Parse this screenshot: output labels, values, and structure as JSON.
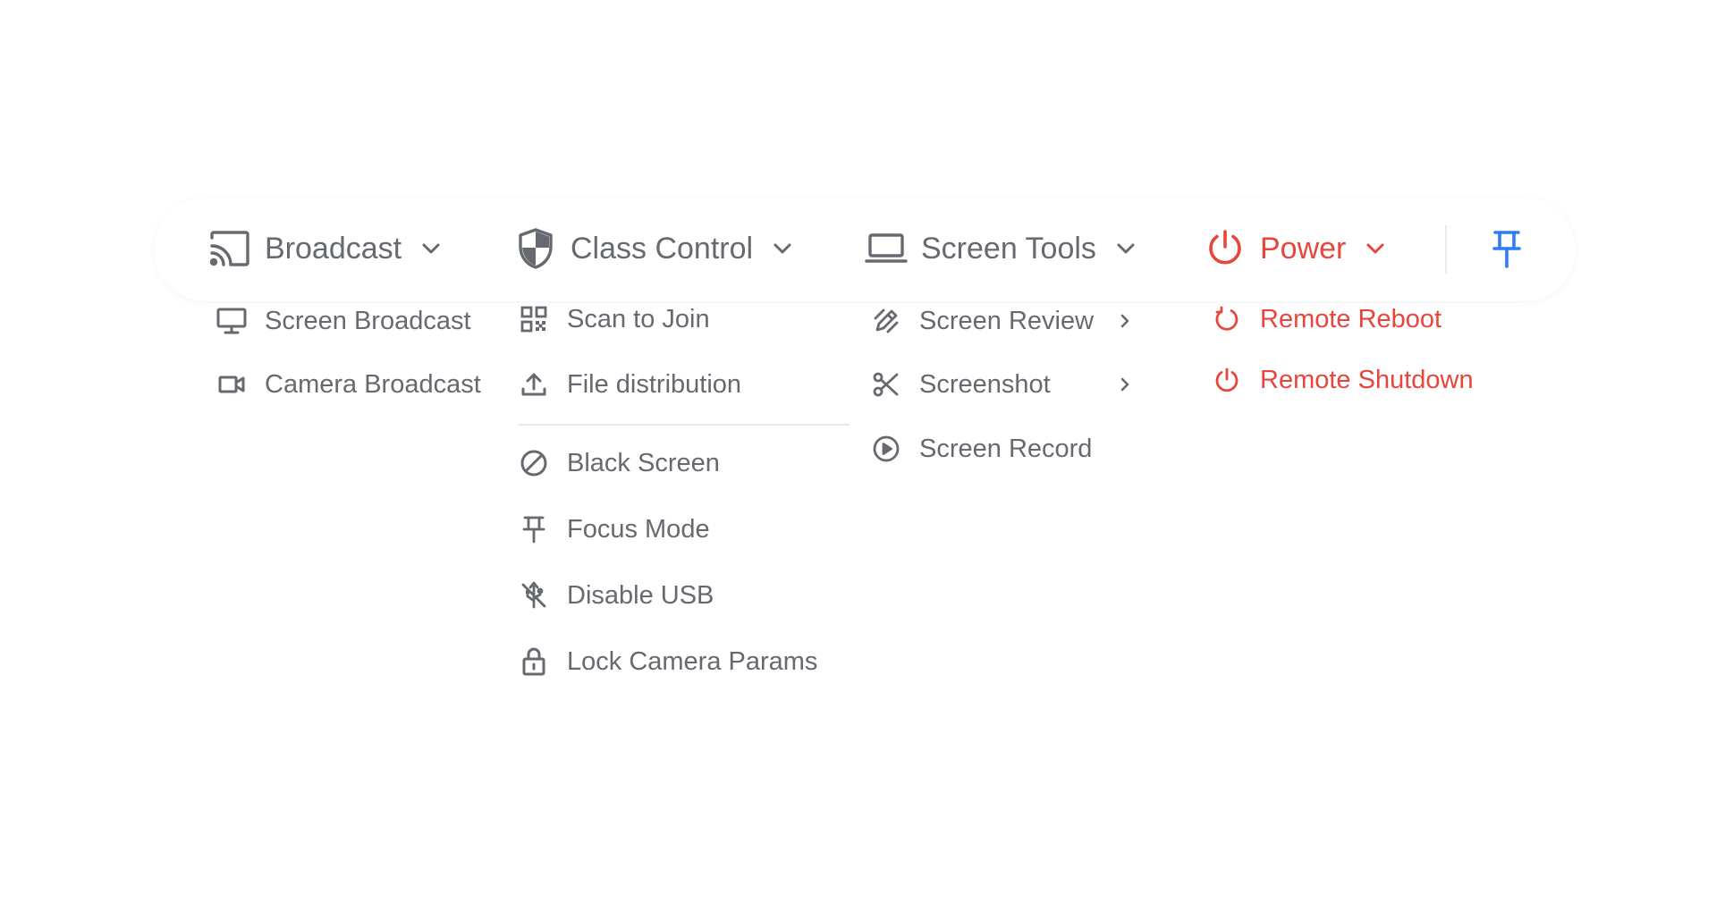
{
  "menus": {
    "broadcast": {
      "label": "Broadcast",
      "icon": "cast-icon",
      "items": [
        {
          "label": "Screen Broadcast",
          "icon": "monitor-icon"
        },
        {
          "label": "Camera Broadcast",
          "icon": "video-camera-icon"
        }
      ]
    },
    "class_control": {
      "label": "Class Control",
      "icon": "shield-icon",
      "items": [
        {
          "label": "Scan to Join",
          "icon": "qr-code-icon"
        },
        {
          "label": "File distribution",
          "icon": "upload-icon"
        },
        {
          "label": "Black Screen",
          "icon": "ban-icon"
        },
        {
          "label": "Focus Mode",
          "icon": "pin-icon"
        },
        {
          "label": "Disable USB",
          "icon": "usb-off-icon"
        },
        {
          "label": "Lock Camera Params",
          "icon": "lock-icon"
        }
      ]
    },
    "screen_tools": {
      "label": "Screen Tools",
      "icon": "laptop-icon",
      "items": [
        {
          "label": "Screen Review",
          "icon": "pen-icon",
          "has_submenu": true
        },
        {
          "label": "Screenshot",
          "icon": "scissors-icon",
          "has_submenu": true
        },
        {
          "label": "Screen Record",
          "icon": "play-circle-icon",
          "has_submenu": false
        }
      ]
    },
    "power": {
      "label": "Power",
      "icon": "power-icon",
      "items": [
        {
          "label": "Remote Reboot",
          "icon": "refresh-icon"
        },
        {
          "label": "Remote Shutdown",
          "icon": "power-icon"
        }
      ]
    }
  },
  "pin_button": {
    "icon": "pin-icon"
  },
  "colors": {
    "text": "#666a70",
    "danger": "#e8453c",
    "accent": "#2f7df6",
    "divider": "#e6e8eb"
  }
}
